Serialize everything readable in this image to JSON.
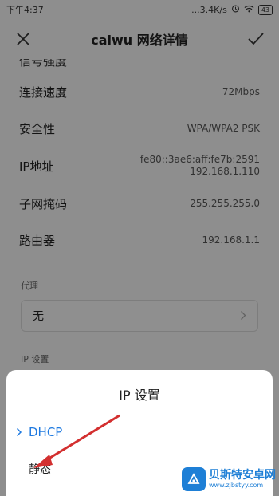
{
  "status_bar": {
    "time": "下午4:37",
    "speed": "...3.4K/s",
    "battery": "43"
  },
  "header": {
    "title": "caiwu  网络详情"
  },
  "details": {
    "cut_label": "信号强度",
    "rows": [
      {
        "label": "连接速度",
        "value": "72Mbps"
      },
      {
        "label": "安全性",
        "value": "WPA/WPA2 PSK"
      },
      {
        "label": "IP地址",
        "value": "fe80::3ae6:aff:fe7b:2591",
        "value2": "192.168.1.110"
      },
      {
        "label": "子网掩码",
        "value": "255.255.255.0"
      },
      {
        "label": "路由器",
        "value": "192.168.1.1"
      }
    ]
  },
  "proxy": {
    "label": "代理",
    "value": "无"
  },
  "ip_settings_label": "IP 设置",
  "sheet": {
    "title": "IP  设置",
    "options": [
      {
        "label": "DHCP",
        "selected": true
      },
      {
        "label": "静态",
        "selected": false
      }
    ]
  },
  "watermark": {
    "name": "贝斯特安卓网",
    "url": "www.zjbstyy.com"
  },
  "colors": {
    "accent": "#1f7ae0",
    "arrow": "#d32f2f",
    "watermark": "#1e7fd6"
  }
}
